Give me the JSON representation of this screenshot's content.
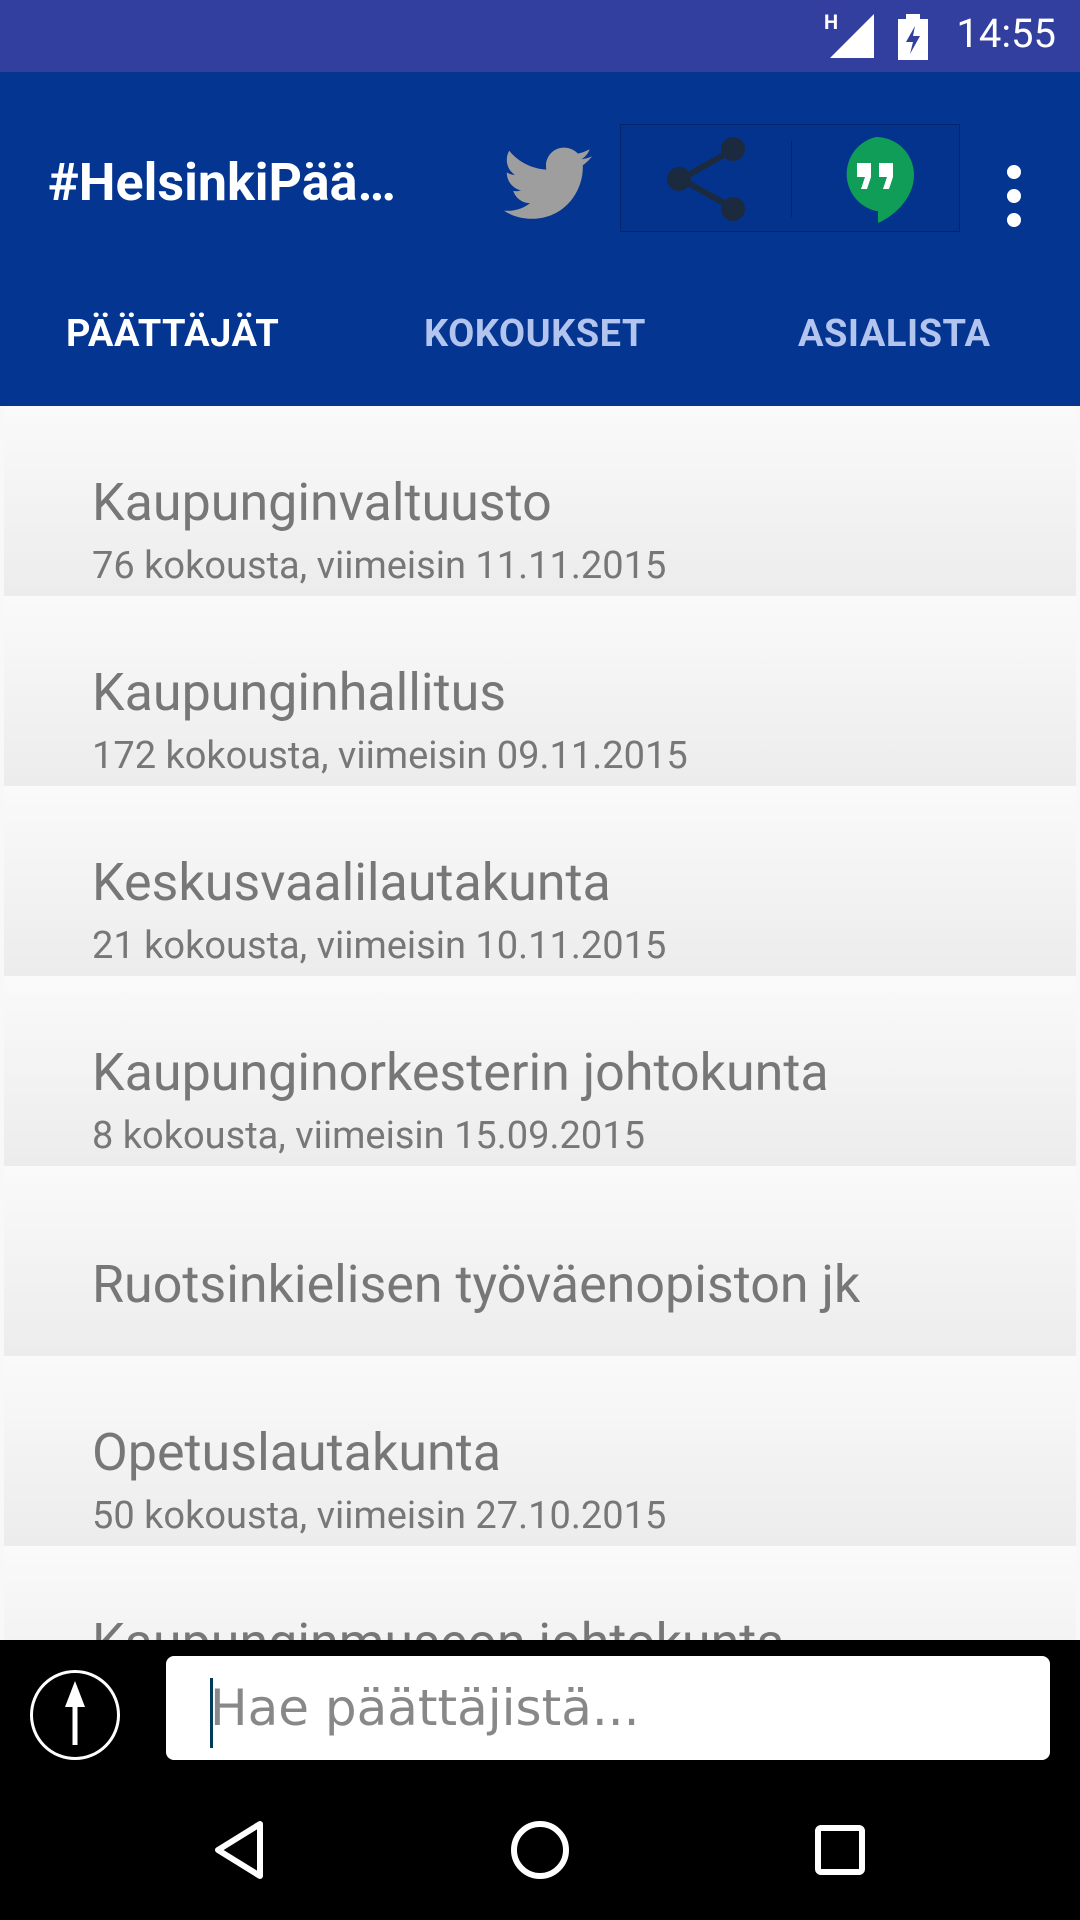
{
  "status_bar": {
    "time": "14:55",
    "network": "H"
  },
  "app_bar": {
    "title": "#HelsinkiPää…",
    "icons": [
      "twitter-icon",
      "share-icon",
      "hangouts-icon",
      "more-vert-icon"
    ],
    "colors": {
      "background": "#043591",
      "status_bar": "#333f9f",
      "hangouts": "#0f9d58",
      "twitter": "#9e9e9e"
    }
  },
  "tabs": [
    {
      "label": "PÄÄTTÄJÄT",
      "selected": true
    },
    {
      "label": "KOKOUKSET",
      "selected": false
    },
    {
      "label": "ASIALISTA",
      "selected": false
    }
  ],
  "list": [
    {
      "name": "Kaupunginvaltuusto",
      "meta": "76 kokousta, viimeisin 11.11.2015"
    },
    {
      "name": "Kaupunginhallitus",
      "meta": "172 kokousta, viimeisin 09.11.2015"
    },
    {
      "name": "Keskusvaalilautakunta",
      "meta": "21 kokousta, viimeisin 10.11.2015"
    },
    {
      "name": "Kaupunginorkesterin johtokunta",
      "meta": "8 kokousta, viimeisin 15.09.2015"
    },
    {
      "name": "Ruotsinkielisen työväenopiston jk",
      "meta": ""
    },
    {
      "name": "Opetuslautakunta",
      "meta": "50 kokousta, viimeisin 27.10.2015"
    },
    {
      "name": "Kaupunginmuseon johtokunta",
      "meta": ""
    }
  ],
  "search": {
    "placeholder": "Hae päättäjistä..."
  }
}
